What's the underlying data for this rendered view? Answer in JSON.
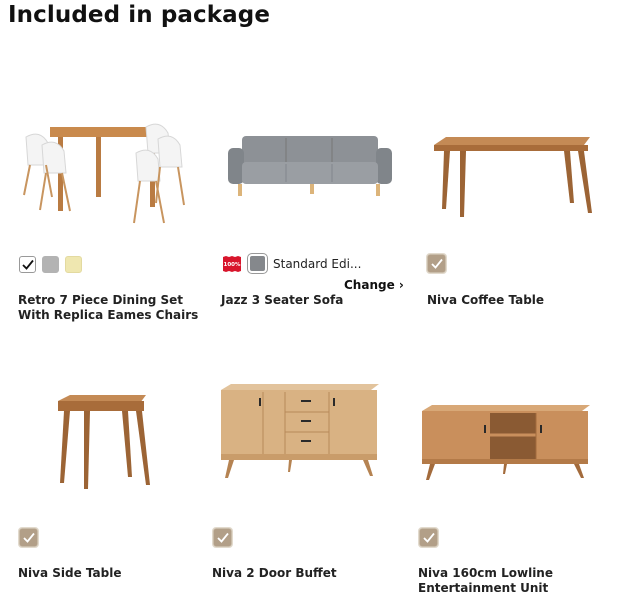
{
  "page": {
    "title": "Included in package"
  },
  "products": [
    {
      "name": "Retro 7 Piece Dining Set With Replica Eames Chairs"
    },
    {
      "name": "Jazz 3 Seater Sofa",
      "fabric_label": "Standard Edi...",
      "change_label": "Change ›",
      "badge": "100%"
    },
    {
      "name": "Niva Coffee Table"
    },
    {
      "name": "Niva Side Table"
    },
    {
      "name": "Niva 2 Door Buffet"
    },
    {
      "name": "Niva 160cm Lowline Entertainment Unit"
    }
  ],
  "swatch_colors": {
    "grey": "#b3b3b3",
    "cream": "#efe7b0",
    "oak": "#b29f88",
    "sofa_grey": "#85888c",
    "badge_red": "#d8152c"
  }
}
